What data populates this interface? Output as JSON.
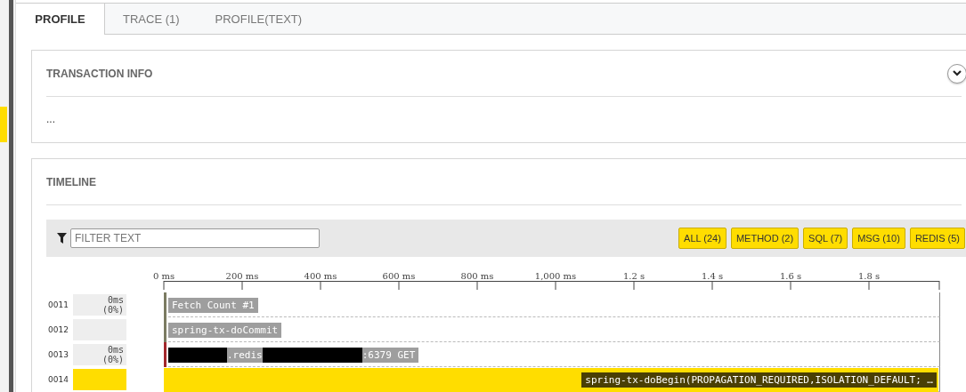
{
  "tabs": [
    {
      "label": "PROFILE",
      "selected": true
    },
    {
      "label": "TRACE (1)",
      "selected": false
    },
    {
      "label": "PROFILE(TEXT)",
      "selected": false
    }
  ],
  "transaction_info": {
    "title": "TRANSACTION INFO",
    "body": "...",
    "expanded": false
  },
  "timeline": {
    "title": "TIMELINE",
    "filter": {
      "placeholder": "FILTER TEXT"
    },
    "filters": [
      "ALL (24)",
      "METHOD (2)",
      "SQL (7)",
      "MSG (10)",
      "REDIS (5)"
    ],
    "axis_labels": [
      "0 ms",
      "200 ms",
      "400 ms",
      "600 ms",
      "800 ms",
      "1,000 ms",
      "1.2 s",
      "1.4 s",
      "1.6 s",
      "1.8 s"
    ],
    "rows": [
      {
        "id": "0011",
        "duration": "0ms (0%)",
        "kind": "marker",
        "color": "#7b7b62",
        "selected": false,
        "label": [
          {
            "kind": "text",
            "text": "Fetch Count #1"
          }
        ]
      },
      {
        "id": "0012",
        "kind": "marker",
        "color": "#7b7b62",
        "selected": false,
        "label": [
          {
            "kind": "text",
            "text": "spring-tx-doCommit"
          }
        ]
      },
      {
        "id": "0013",
        "duration": "0ms (0%)",
        "kind": "marker",
        "color": "#a3272b",
        "selected": false,
        "label": [
          {
            "kind": "redacted"
          },
          {
            "kind": "text",
            "text": ".redis"
          },
          {
            "kind": "redacted"
          },
          {
            "kind": "text",
            "text": ":6379 GET"
          }
        ]
      },
      {
        "id": "0014",
        "kind": "bar",
        "color": "#ffdd00",
        "selected": true,
        "label": [
          {
            "kind": "text",
            "text": "spring-tx-doBegin(PROPAGATION_REQUIRED,ISOLATION_DEFAULT; …"
          }
        ]
      }
    ]
  }
}
